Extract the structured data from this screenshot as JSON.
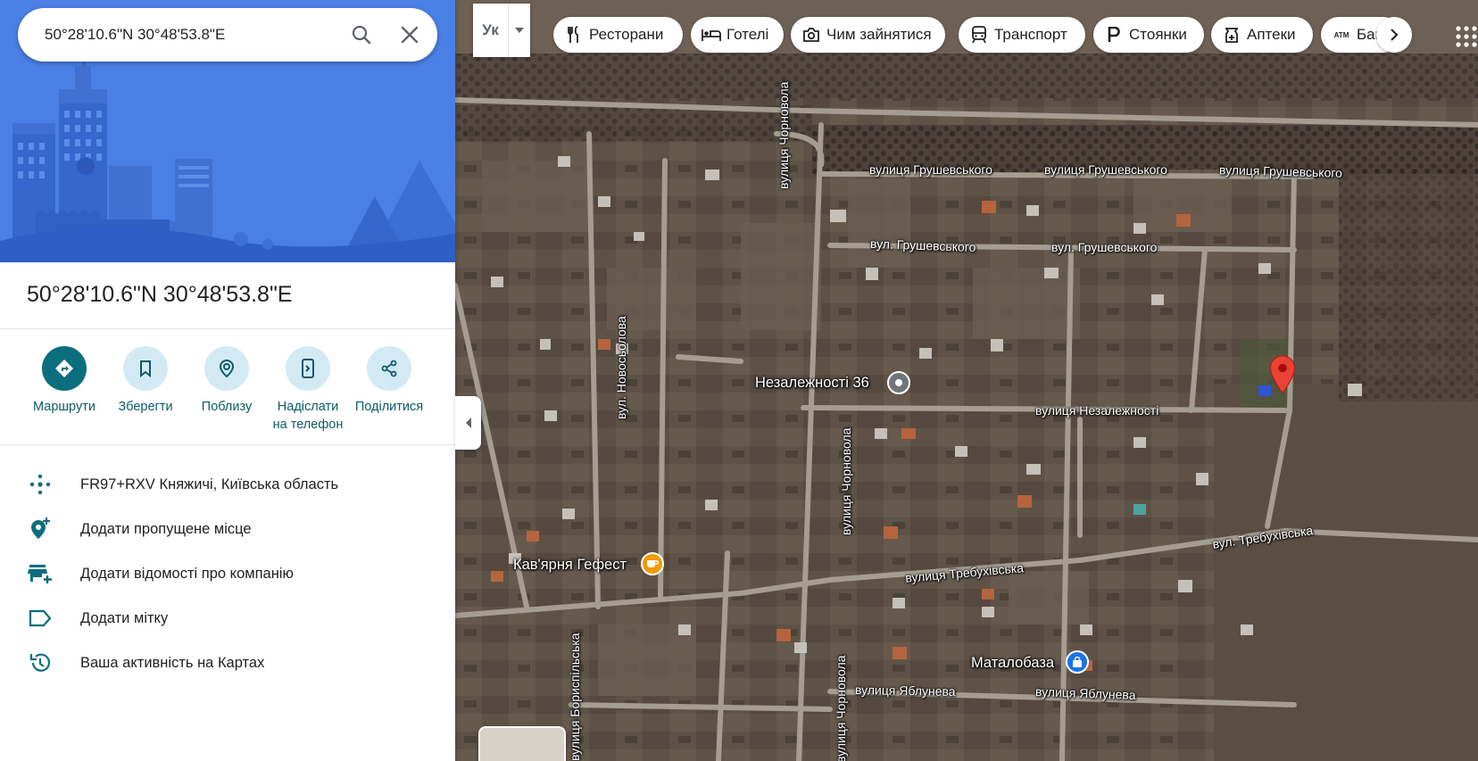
{
  "search": {
    "query": "50°28'10.6\"N 30°48'53.8\"E",
    "search_icon": "search-icon",
    "close_icon": "close-icon"
  },
  "place": {
    "title": "50°28'10.6\"N 30°48'53.8\"E"
  },
  "actions": [
    {
      "label": "Маршрути",
      "icon": "directions-icon"
    },
    {
      "label": "Зберегти",
      "icon": "bookmark-icon"
    },
    {
      "label": "Поблизу",
      "icon": "nearby-icon"
    },
    {
      "label": "Надіслати на телефон",
      "line1": "Надіслати",
      "line2": "на телефон",
      "icon": "send-to-phone-icon"
    },
    {
      "label": "Поділитися",
      "icon": "share-icon"
    }
  ],
  "info": [
    {
      "text": "FR97+RXV Княжичі, Київська область",
      "icon": "plus-code-icon"
    },
    {
      "text": "Додати пропущене місце",
      "icon": "add-place-icon"
    },
    {
      "text": "Додати відомості про компанію",
      "icon": "add-business-icon"
    },
    {
      "text": "Додати мітку",
      "icon": "label-icon"
    },
    {
      "text": "Ваша активність на Картах",
      "icon": "history-icon"
    }
  ],
  "layer_toggle": {
    "label": "Ук"
  },
  "chips": [
    {
      "label": "Ресторани",
      "icon": "restaurant-icon"
    },
    {
      "label": "Готелі",
      "icon": "hotel-icon"
    },
    {
      "label": "Чим зайнятися",
      "icon": "camera-icon"
    },
    {
      "label": "Транспорт",
      "icon": "transit-icon"
    },
    {
      "label": "Стоянки",
      "icon": "parking-icon"
    },
    {
      "label": "Аптеки",
      "icon": "pharmacy-icon"
    },
    {
      "label": "Бан",
      "icon": "atm-icon",
      "icon_text": "ATM"
    }
  ],
  "map": {
    "roads": {
      "hrushevskoho_1": "вулиця Грушевського",
      "hrushevskoho_2": "вулиця Грушевського",
      "hrushevskoho_3": "вулиця Грушевського",
      "hrushevskoho_short_1": "вул. Грушевського",
      "hrushevskoho_short_2": "вул. Грушевського",
      "chornovola_1": "вулиця Чорновола",
      "chornovola_2": "вулиця Чорновола",
      "chornovola_3": "вулиця Чорновола",
      "novosolova": "вул. Новосьолова",
      "nezalezhnosti": "вулиця Незалежності",
      "trebukhivska": "вулиця Требухівська",
      "trebukhivska_short": "вул. Требухівська",
      "yabluneva_1": "вулиця Яблунева",
      "yabluneva_2": "вулиця Яблунева",
      "boryspilska": "вулиця Бориспільська"
    },
    "pois": {
      "address": "Незалежності 36",
      "cafe": "Кав'ярня Гефест",
      "store": "Маталобаза"
    },
    "colors": {
      "pin": "#ea4335",
      "cafe": "#f29900",
      "store": "#1a73e8",
      "address": "#70757a"
    }
  }
}
